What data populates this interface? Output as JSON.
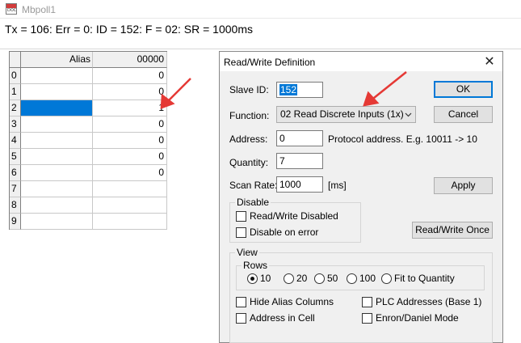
{
  "child_window": {
    "title": "Mbpoll1",
    "icon": "document-icon",
    "icon_text": "DOC"
  },
  "status_line": "Tx = 106: Err = 0: ID = 152: F = 02: SR = 1000ms",
  "grid": {
    "headers": {
      "alias": "Alias",
      "value": "00000"
    },
    "rows": [
      {
        "index": "0",
        "alias": "",
        "value": "0"
      },
      {
        "index": "1",
        "alias": "",
        "value": "0"
      },
      {
        "index": "2",
        "alias": "",
        "value": "1"
      },
      {
        "index": "3",
        "alias": "",
        "value": "0"
      },
      {
        "index": "4",
        "alias": "",
        "value": "0"
      },
      {
        "index": "5",
        "alias": "",
        "value": "0"
      },
      {
        "index": "6",
        "alias": "",
        "value": "0"
      },
      {
        "index": "7",
        "alias": "",
        "value": ""
      },
      {
        "index": "8",
        "alias": "",
        "value": ""
      },
      {
        "index": "9",
        "alias": "",
        "value": ""
      }
    ],
    "selected_row": 2
  },
  "dialog": {
    "title": "Read/Write Definition",
    "close_glyph": "✕",
    "slave_id": {
      "label": "Slave ID:",
      "value": "152"
    },
    "function": {
      "label": "Function:",
      "selected": "02 Read Discrete Inputs (1x)"
    },
    "address": {
      "label": "Address:",
      "value": "0",
      "hint": "Protocol address. E.g. 10011 -> 10"
    },
    "quantity": {
      "label": "Quantity:",
      "value": "7"
    },
    "scan_rate": {
      "label": "Scan Rate:",
      "value": "1000",
      "unit": "[ms]"
    },
    "buttons": {
      "ok": "OK",
      "cancel": "Cancel",
      "apply": "Apply",
      "read_write_once": "Read/Write Once"
    },
    "disable": {
      "label": "Disable",
      "read_write_disabled": {
        "label": "Read/Write Disabled",
        "checked": false
      },
      "disable_on_error": {
        "label": "Disable on error",
        "checked": false
      }
    },
    "view": {
      "label": "View",
      "rows": {
        "label": "Rows",
        "options": [
          "10",
          "20",
          "50",
          "100",
          "Fit to Quantity"
        ],
        "selected": "10"
      },
      "hide_alias_columns": {
        "label": "Hide Alias Columns",
        "checked": false
      },
      "address_in_cell": {
        "label": "Address in Cell",
        "checked": false
      },
      "plc_addresses": {
        "label": "PLC Addresses (Base 1)",
        "checked": false
      },
      "enron_daniel_mode": {
        "label": "Enron/Daniel Mode",
        "checked": false
      }
    }
  },
  "colors": {
    "selection": "#0078d7",
    "annotation_arrow": "#e53935",
    "dialog_bg": "#f0f0f0"
  }
}
